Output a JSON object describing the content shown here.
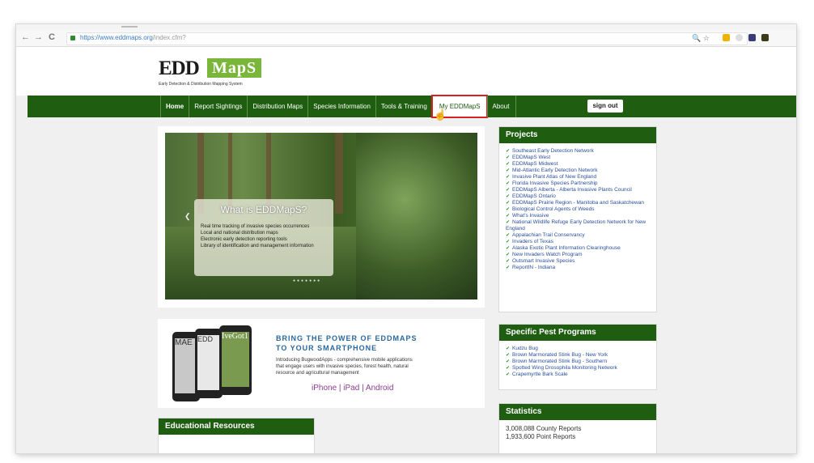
{
  "browser": {
    "url_secure": "https://www.eddmaps.org",
    "url_path": "/index.cfm?",
    "back": "←",
    "forward": "→",
    "reload": "C",
    "right_icons": "🔍 ☆"
  },
  "site": {
    "logo_edd": "EDD",
    "logo_maps": "MapS",
    "logo_tagline": "Early Detection & Distribution Mapping System"
  },
  "nav": {
    "items": [
      "Home",
      "Report Sightings",
      "Distribution Maps",
      "Species Information",
      "Tools & Training",
      "My EDDMapS",
      "About"
    ],
    "signout": "sign out"
  },
  "hero": {
    "title": "What is EDDMapS?",
    "bullets": [
      "Real time tracking of invasive species occurrences",
      "Local and national distribution maps",
      "Electronic early detection reporting tools",
      "Library of identification and management information"
    ]
  },
  "promo": {
    "headline_line1": "BRING THE POWER OF EDDMAPS",
    "headline_line2": "TO YOUR SMARTPHONE",
    "body": "Introducing BugwoodApps - comprehensive mobile applications that engage users with invasive species, forest health, natural resource and agricultural management",
    "links": "iPhone | iPad | Android",
    "phone_labels": [
      "MAE",
      "EDD",
      "IveGot1"
    ]
  },
  "projects": {
    "title": "Projects",
    "items": [
      "Southeast Early Detection Network",
      "EDDMapS West",
      "EDDMapS Midwest",
      "Mid-Atlantic Early Detection Network",
      "Invasive Plant Atlas of New England",
      "Florida Invasive Species Partnership",
      "EDDMapS Alberta - Alberta Invasive Plants Council",
      "EDDMapS Ontario",
      "EDDMapS Prairie Region - Manitoba and Saskatchewan",
      "Biological Control Agents of Weeds",
      "What's Invasive",
      "National Wildlife Refuge Early Detection Network for New England",
      "Appalachian Trail Conservancy",
      "Invaders of Texas",
      "Alaska Exotic Plant Information Clearinghouse",
      "New Invaders Watch Program",
      "Outsmart Invasive Species",
      "ReportIN - Indiana"
    ]
  },
  "pests": {
    "title": "Specific Pest Programs",
    "items": [
      "Kudzu Bug",
      "Brown Marmorated Stink Bug - New York",
      "Brown Marmorated Stink Bug - Southern",
      "Spotted Wing Drosophila Monitoring Network",
      "Crapemyrtle Bark Scale"
    ]
  },
  "stats": {
    "title": "Statistics",
    "rows": [
      "3,008,088 County Reports",
      "1,933,600 Point Reports"
    ]
  },
  "edu": {
    "title": "Educational Resources"
  }
}
